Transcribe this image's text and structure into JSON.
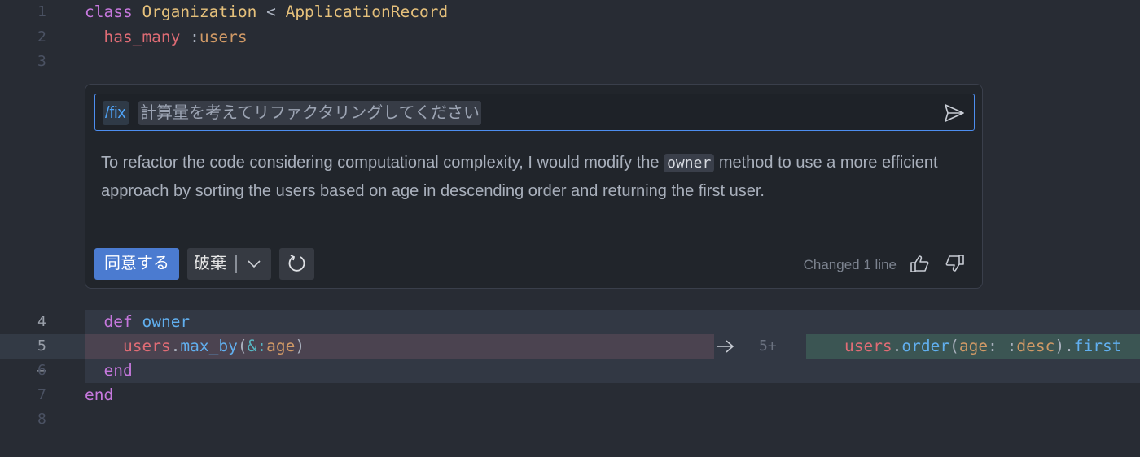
{
  "editor": {
    "lines": [
      {
        "num": "1",
        "tokens": [
          {
            "t": "class ",
            "c": "kw"
          },
          {
            "t": "Organization",
            "c": "cls"
          },
          {
            "t": " < ",
            "c": "pl"
          },
          {
            "t": "ApplicationRecord",
            "c": "cls"
          }
        ]
      },
      {
        "num": "2",
        "tokens": [
          {
            "t": "  "
          },
          {
            "t": "has_many",
            "c": "red"
          },
          {
            "t": " :",
            "c": "pl"
          },
          {
            "t": "users",
            "c": "sym"
          }
        ]
      },
      {
        "num": "3",
        "tokens": []
      },
      {
        "num": "4",
        "tokens": [
          {
            "t": "  "
          },
          {
            "t": "def",
            "c": "kw"
          },
          {
            "t": " "
          },
          {
            "t": "owner",
            "c": "fn"
          }
        ]
      },
      {
        "num": "5—",
        "tokens": [
          {
            "t": "    "
          },
          {
            "t": "users",
            "c": "red"
          },
          {
            "t": ".",
            "c": "pl"
          },
          {
            "t": "max_by",
            "c": "fn"
          },
          {
            "t": "(",
            "c": "pl"
          },
          {
            "t": "&:",
            "c": "op"
          },
          {
            "t": "age",
            "c": "sym"
          },
          {
            "t": ")",
            "c": "pl"
          }
        ]
      },
      {
        "num": "6",
        "tokens": [
          {
            "t": "  "
          },
          {
            "t": "end",
            "c": "kw"
          }
        ]
      },
      {
        "num": "7",
        "tokens": [
          {
            "t": "end",
            "c": "kw"
          }
        ]
      },
      {
        "num": "8",
        "tokens": []
      }
    ],
    "added_line": {
      "num": "5+",
      "tokens": [
        {
          "t": "    "
        },
        {
          "t": "users",
          "c": "red"
        },
        {
          "t": ".",
          "c": "pl"
        },
        {
          "t": "order",
          "c": "fn"
        },
        {
          "t": "(",
          "c": "pl"
        },
        {
          "t": "age",
          "c": "sym"
        },
        {
          "t": ": :",
          "c": "pl"
        },
        {
          "t": "desc",
          "c": "sym"
        },
        {
          "t": ").",
          "c": "pl"
        },
        {
          "t": "first",
          "c": "fn"
        }
      ]
    }
  },
  "chat": {
    "command": "/fix",
    "prompt": "計算量を考えてリファクタリングしてください",
    "response_before": "To refactor the code considering computational complexity, I would modify the ",
    "response_code": "owner",
    "response_after": " method to use a more efficient approach by sorting the users based on age in descending order and returning the first user.",
    "accept_label": "同意する",
    "discard_label": "破棄",
    "changed_text": "Changed 1 line"
  },
  "colors": {
    "accent": "#4b7bd0",
    "input_border": "#4d8ef0",
    "deleted_bg": "#4b4350",
    "added_bg": "#3b5553"
  }
}
